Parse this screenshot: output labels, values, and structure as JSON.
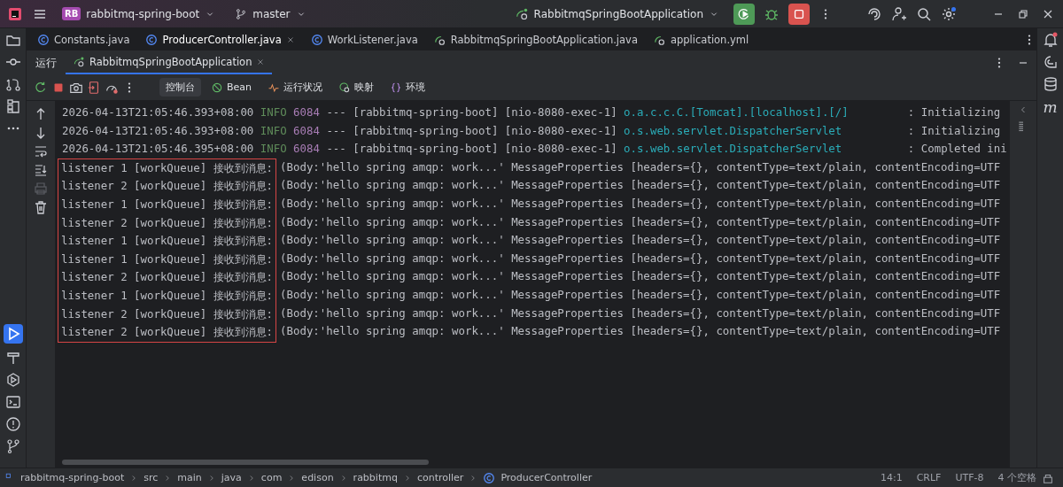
{
  "title_bar": {
    "project_badge": "RB",
    "project": "rabbitmq-spring-boot",
    "branch": "master",
    "run_config": "RabbitmqSpringBootApplication"
  },
  "editor_tabs": [
    {
      "label": "Constants.java",
      "selected": false
    },
    {
      "label": "ProducerController.java",
      "selected": true
    },
    {
      "label": "WorkListener.java",
      "selected": false
    },
    {
      "label": "RabbitmqSpringBootApplication.java",
      "selected": false
    },
    {
      "label": "application.yml",
      "selected": false
    }
  ],
  "run_panel": {
    "label": "运行",
    "tabs": [
      {
        "label": "RabbitmqSpringBootApplication",
        "selected": true
      }
    ],
    "console_tabs": [
      {
        "label": "控制台",
        "selected": true
      },
      {
        "label": "Bean",
        "selected": false
      },
      {
        "label": "运行状况",
        "selected": false
      },
      {
        "label": "映射",
        "selected": false
      },
      {
        "label": "环境",
        "selected": false
      }
    ]
  },
  "console": {
    "log_lines": [
      {
        "timestamp": "2026-04-13T21:05:46.393+08:00",
        "level": "INFO",
        "pid": "6084",
        "separator": "---",
        "app": "[rabbitmq-spring-boot]",
        "thread": "[nio-8080-exec-1]",
        "logger": "o.a.c.c.C.[Tomcat].[localhost].[/]",
        "message": ": Initializing"
      },
      {
        "timestamp": "2026-04-13T21:05:46.393+08:00",
        "level": "INFO",
        "pid": "6084",
        "separator": "---",
        "app": "[rabbitmq-spring-boot]",
        "thread": "[nio-8080-exec-1]",
        "logger": "o.s.web.servlet.DispatcherServlet",
        "message": ": Initializing"
      },
      {
        "timestamp": "2026-04-13T21:05:46.395+08:00",
        "level": "INFO",
        "pid": "6084",
        "separator": "---",
        "app": "[rabbitmq-spring-boot]",
        "thread": "[nio-8080-exec-1]",
        "logger": "o.s.web.servlet.DispatcherServlet",
        "message": ": Completed ini"
      }
    ],
    "messages": [
      {
        "prefix": "listener 1 [workQueue] 接收到消息:",
        "body": "(Body:'hello spring amqp: work...' MessageProperties [headers={}, contentType=text/plain, contentEncoding=UTF"
      },
      {
        "prefix": "listener 2 [workQueue] 接收到消息:",
        "body": "(Body:'hello spring amqp: work...' MessageProperties [headers={}, contentType=text/plain, contentEncoding=UTF"
      },
      {
        "prefix": "listener 1 [workQueue] 接收到消息:",
        "body": "(Body:'hello spring amqp: work...' MessageProperties [headers={}, contentType=text/plain, contentEncoding=UTF"
      },
      {
        "prefix": "listener 2 [workQueue] 接收到消息:",
        "body": "(Body:'hello spring amqp: work...' MessageProperties [headers={}, contentType=text/plain, contentEncoding=UTF"
      },
      {
        "prefix": "listener 1 [workQueue] 接收到消息:",
        "body": "(Body:'hello spring amqp: work...' MessageProperties [headers={}, contentType=text/plain, contentEncoding=UTF"
      },
      {
        "prefix": "listener 1 [workQueue] 接收到消息:",
        "body": "(Body:'hello spring amqp: work...' MessageProperties [headers={}, contentType=text/plain, contentEncoding=UTF"
      },
      {
        "prefix": "listener 2 [workQueue] 接收到消息:",
        "body": "(Body:'hello spring amqp: work...' MessageProperties [headers={}, contentType=text/plain, contentEncoding=UTF"
      },
      {
        "prefix": "listener 1 [workQueue] 接收到消息:",
        "body": "(Body:'hello spring amqp: work...' MessageProperties [headers={}, contentType=text/plain, contentEncoding=UTF"
      },
      {
        "prefix": "listener 2 [workQueue] 接收到消息:",
        "body": "(Body:'hello spring amqp: work...' MessageProperties [headers={}, contentType=text/plain, contentEncoding=UTF"
      },
      {
        "prefix": "listener 2 [workQueue] 接收到消息:",
        "body": "(Body:'hello spring amqp: work...' MessageProperties [headers={}, contentType=text/plain, contentEncoding=UTF"
      }
    ]
  },
  "right_strip": {
    "maven_label": "m"
  },
  "breadcrumbs": [
    "rabbitmq-spring-boot",
    "src",
    "main",
    "java",
    "com",
    "edison",
    "rabbitmq",
    "controller",
    "ProducerController"
  ],
  "status_bar": [
    "14:1",
    "CRLF",
    "UTF-8",
    "4 个空格"
  ]
}
